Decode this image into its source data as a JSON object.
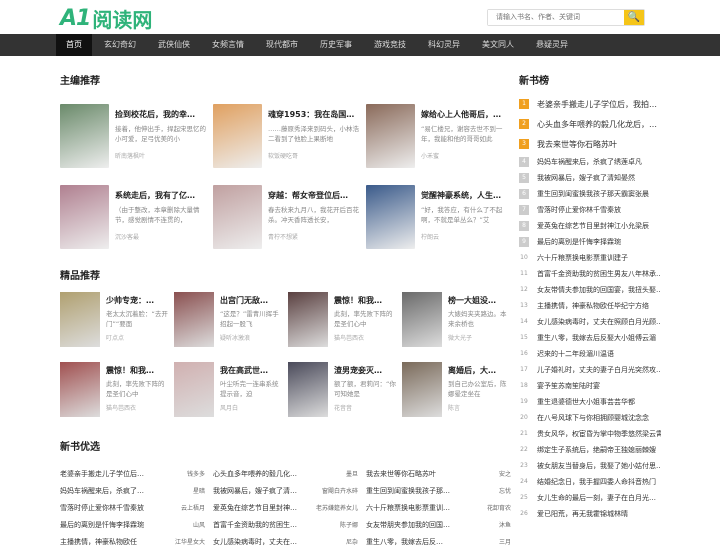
{
  "site": {
    "logo_mark": "A1",
    "logo_text": "阅读网"
  },
  "search": {
    "placeholder": "请输入书名、作者、关键词",
    "button": "🔍"
  },
  "nav": [
    "首页",
    "玄幻奇幻",
    "武侠仙侠",
    "女频言情",
    "现代都市",
    "历史军事",
    "游戏竞技",
    "科幻灵异",
    "美文同人",
    "悬疑灵异"
  ],
  "editor": {
    "title": "主编推荐",
    "books": [
      {
        "title": "捡到校花后，我的幸…",
        "desc": "接着，他伸出手，捍起宋思忆的小可爱，足弓优美的小",
        "author": "昕南落枫叶",
        "color": "#6a8a6a"
      },
      {
        "title": "魂穿1953：我在岛国…",
        "desc": "……藤原秀泽来到码头，小林浩二看到了他脸上果断地",
        "author": "软饭硬吃哥",
        "color": "#e0a060"
      },
      {
        "title": "嫁给心上人他哥后，…",
        "desc": "“易仁楼兄，谢容去世不到一年，我能和他的哥哥如此",
        "author": "小禾蜜",
        "color": "#8a6a5a"
      },
      {
        "title": "系统走后，我有了亿…",
        "desc": "（由于整改，本章删除大量情节，感觉剧情不连贯的，",
        "author": "沉沙客最",
        "color": "#b08090"
      },
      {
        "title": "穿越：帮女帝登位后…",
        "desc": "春去秋来九月八，我花开后百花杀。冲天香阵透长安，",
        "author": "青柠不想紧",
        "color": "#c0a0a0"
      },
      {
        "title": "觉醒神豪系统，人生…",
        "desc": "“好，我答应，有什么了不起啊，不就是单丛么？”艾",
        "author": "柠朗云",
        "color": "#3a5a8a"
      }
    ]
  },
  "fine": {
    "title": "精品推荐",
    "books": [
      {
        "title": "少帅专宠：…",
        "desc": "老太太沉着脸：“去开门”“要面",
        "author": "叮点点",
        "color": "#b0a070"
      },
      {
        "title": "出宫门无敌…",
        "desc": "“这是？”雷青川挥手招起一股飞",
        "author": "疑听冰激浪",
        "color": "#8a5050"
      },
      {
        "title": "震惊！和我…",
        "desc": "此刻，率先败下阵的是圣们心中",
        "author": "猫鸟芭西衣",
        "color": "#5a4040"
      },
      {
        "title": "榜一大姐没…",
        "desc": "大婊妈夹夹路边。本来余桥也",
        "author": "微大光子",
        "color": "#6a6a6a"
      },
      {
        "title": "震惊！和我…",
        "desc": "此刻，率先败下阵的是圣们心中",
        "author": "猫鸟芭西衣",
        "color": "#a05050"
      },
      {
        "title": "我在高武世…",
        "desc": "叶尘听完一连串系统提示音，迫",
        "author": "风月白",
        "color": "#d0b0b0"
      },
      {
        "title": "渣男宠妾灭…",
        "desc": "额了额，君莉问：“你可知她是",
        "author": "花音音",
        "color": "#4a4a5a"
      },
      {
        "title": "离婚后，大…",
        "desc": "到自己办公室后，陈娜晕定坐在",
        "author": "陈言",
        "color": "#7a6a5a"
      }
    ]
  },
  "fresh": {
    "title": "新书优选",
    "rows": [
      [
        {
          "name": "老婆亲手搬走儿子学位后…",
          "author": "钱多多"
        },
        {
          "name": "心头血多年喂养的毅几化…",
          "author": "墨旦"
        },
        {
          "name": "我去来世等你石略苏叶",
          "author": "安之"
        }
      ],
      [
        {
          "name": "妈妈车祸醒来后，杀疯了…",
          "author": "星暗"
        },
        {
          "name": "我被网暴后，嫂子疯了清…",
          "author": "窗飓白卉水碎"
        },
        {
          "name": "重生回到闺蜜换我孩子那…",
          "author": "忘忧"
        }
      ],
      [
        {
          "name": "雪落时停止爱你林千雪秦放",
          "author": "云上梧月"
        },
        {
          "name": "爱英兔在综艺节目里封神…",
          "author": "老苏嫌筵养女儿"
        },
        {
          "name": "六十斤粮票换电影票重训…",
          "author": "花卸育农"
        }
      ],
      [
        {
          "name": "最后的离别是忏悔李择霖琬",
          "author": "山风"
        },
        {
          "name": "首富千金资助我的贫困生…",
          "author": "陈子娜"
        },
        {
          "name": "女友带朋夹参加我的回国…",
          "author": "沐鱼"
        }
      ],
      [
        {
          "name": "主播携情，神豪私物欧任",
          "author": "江华星女大"
        },
        {
          "name": "女儿感染病毒时，丈夫在…",
          "author": "尼杂"
        },
        {
          "name": "重生八零，我嫁去后反…",
          "author": "三月"
        }
      ]
    ]
  },
  "side": {
    "title": "新书榜",
    "items": [
      "老婆亲手搬走儿子学位后，我拍…",
      "心头血多年喂养的毅几化龙后，…",
      "我去来世等你石略苏叶",
      "妈妈车祸醒来后，杀疯了绣莲卓凡",
      "我被网暴后，嫂子疯了清知晏然",
      "重生回到闺蜜换我孩子那天霸窦张晨",
      "雪落时停止爱你林千雪秦放",
      "爱英兔在综艺节目里封神江小允梁辰",
      "最后的离别是忏悔李择霖琬",
      "六十斤粮票换电影票重训建子",
      "首富千金资助我的贫困生男友八年林承…",
      "女友带情夫参加我的回国宴，我扭头娶…",
      "主播携情，神豪私物欧任毕纪宁方络",
      "女儿感染病毒时，丈夫在照顾白月光顾…",
      "重生八零，我嫁去后反娶大小姐傅云湄",
      "迟来的十二年段湄川温语",
      "儿子婚礼时，丈夫的妻子白月光突然攻…",
      "宴予笙苏南笙陆时宴",
      "重生退婆德世大小姐事芸芸华都",
      "在八号风球下与你相拥顾婴城沈念念",
      "贵女风华，权宦昏为掌中物季悠然梁云霄",
      "绑定生子系统后，绝嗣帝王独媳丽棘嫂",
      "被女朋友当替身后，我娶了她小姑付思…",
      "结婚纪念日，我手握四委人命抖音热门",
      "女儿生命的最后一刻，妻子在白月光…",
      "爱已阳荒，再无我霍锦城林晴"
    ]
  },
  "colors": {
    "accent": "#2fb37a",
    "nav_bg": "#333333",
    "search_btn": "#f5c518",
    "rank_top": "#f0a020"
  }
}
